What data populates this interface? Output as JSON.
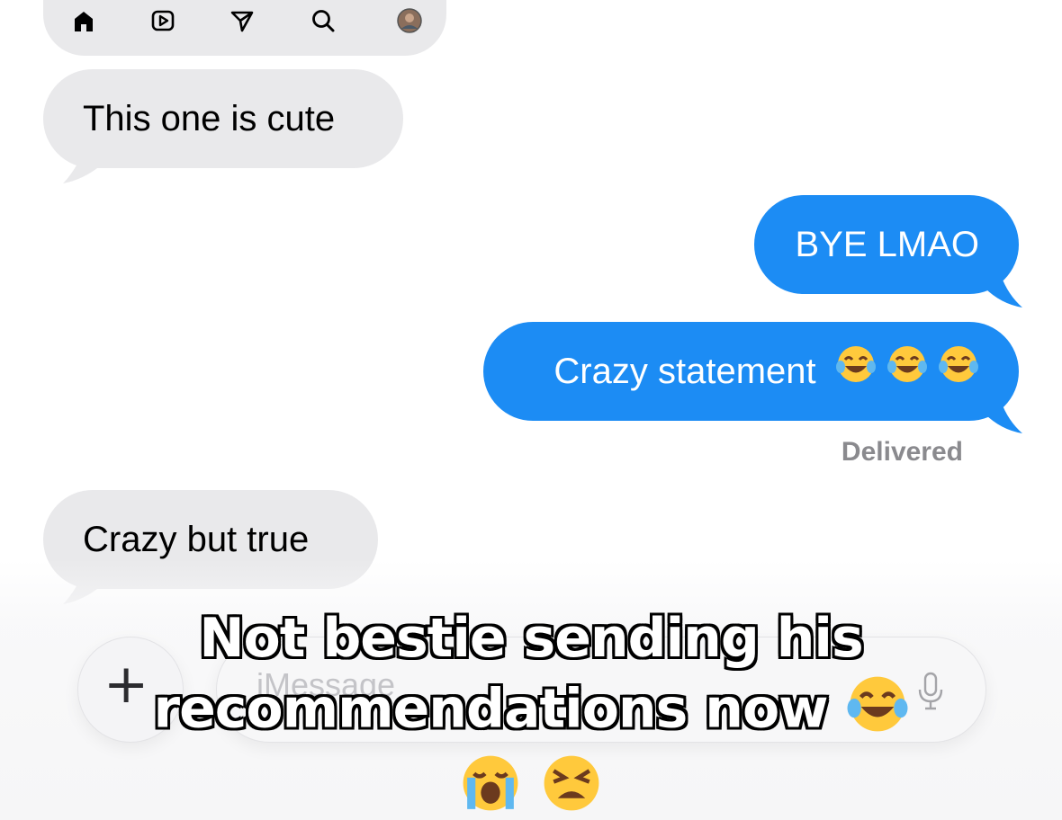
{
  "nav": {
    "items": [
      "home-icon",
      "reels-icon",
      "share-icon",
      "search-icon",
      "profile-avatar"
    ]
  },
  "messages": [
    {
      "direction": "incoming",
      "text": "This one is cute"
    },
    {
      "direction": "outgoing",
      "text": "BYE LMAO"
    },
    {
      "direction": "outgoing",
      "text": "Crazy statement",
      "emoji": "laughing-crying-emoji x3"
    },
    {
      "direction": "incoming",
      "text": "Crazy but true"
    }
  ],
  "status": {
    "delivered": "Delivered"
  },
  "compose": {
    "placeholder": "iMessage",
    "add_icon": "plus-icon",
    "mic_icon": "microphone-icon"
  },
  "caption": {
    "line1": "Not bestie sending his",
    "line2": "recommendations now",
    "emojis": [
      "laughing-crying-emoji",
      "loudly-crying-emoji",
      "weary-face-emoji"
    ]
  },
  "colors": {
    "incoming_bubble": "#e9e9eb",
    "outgoing_bubble": "#1c8cf4",
    "delivered_text": "#8a8a8e"
  }
}
